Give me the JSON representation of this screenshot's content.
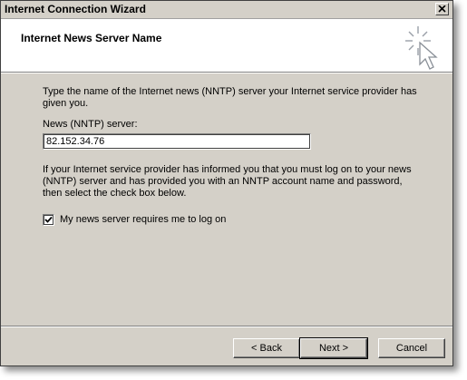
{
  "window": {
    "title": "Internet Connection Wizard"
  },
  "header": {
    "page_title": "Internet News Server Name",
    "icon": "wizard-icon"
  },
  "content": {
    "intro": "Type the name of the Internet news (NNTP) server your Internet service provider has given you.",
    "server_label": "News (NNTP) server:",
    "server_value": "82.152.34.76",
    "logon_note": "If your Internet service provider has informed you that you must log on to your news (NNTP) server and has provided you with an NNTP account name and password, then select the check box below.",
    "logon_checkbox": {
      "label": "My news server requires me to log on",
      "checked": true
    }
  },
  "buttons": {
    "back": "< Back",
    "next": "Next >",
    "cancel": "Cancel"
  }
}
